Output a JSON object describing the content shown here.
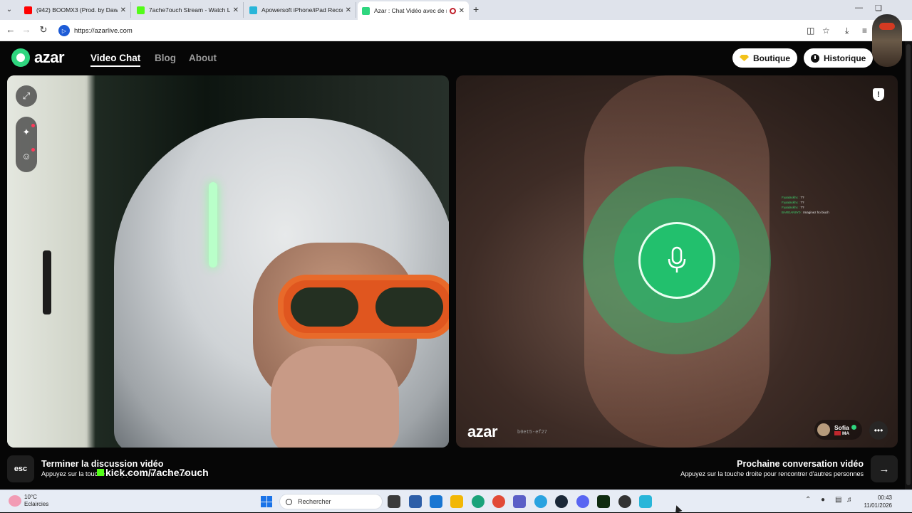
{
  "browser": {
    "tabs": [
      {
        "title": "(942) BOOMX3 (Prod. by Dawe",
        "fav_color": "#ff0000"
      },
      {
        "title": "7ache7ouch Stream - Watch Li",
        "fav_color": "#53fc18"
      },
      {
        "title": "Apowersoft iPhone/iPad Recor",
        "fav_color": "#29b6d9"
      },
      {
        "title": "Azar : Chat Vidéo avec de n",
        "fav_color": "#2fd67f",
        "active": true
      }
    ],
    "url": "https://azarlive.com"
  },
  "header": {
    "logo": "azar",
    "nav": [
      {
        "label": "Video Chat",
        "active": true
      },
      {
        "label": "Blog"
      },
      {
        "label": "About"
      }
    ],
    "shop_label": "Boutique",
    "history_label": "Historique"
  },
  "remote": {
    "watermark": "azar",
    "watermark_id": "b0et5-ef27",
    "peer_name": "Sofia",
    "peer_country": "MA",
    "chat_overlay": [
      {
        "user": "Fyaalaskhx :",
        "msg": "??"
      },
      {
        "user": "Fyaalaskhx :",
        "msg": "??"
      },
      {
        "user": "Fyaalaskhx :",
        "msg": "??"
      },
      {
        "user": "BAREAN9Y0 :",
        "msg": "Imaginez ho biuch"
      }
    ]
  },
  "controls": {
    "esc_key": "esc",
    "end_title": "Terminer la discussion vidéo",
    "end_sub": "Appuyez sur la touche Échap pour terminer le chat vidéo.",
    "kick_overlay": "kick.com/7ache7ouch",
    "next_title": "Prochaine conversation vidéo",
    "next_sub": "Appuyez sur la touche droite pour rencontrer d'autres personnes"
  },
  "taskbar": {
    "weather_temp": "10°C",
    "weather_desc": "Eclaircies",
    "search_placeholder": "Rechercher",
    "time": "00:43",
    "date": "11/01/2026"
  },
  "colors": {
    "accent": "#2fd67f",
    "mic_green": "#22c06d"
  }
}
